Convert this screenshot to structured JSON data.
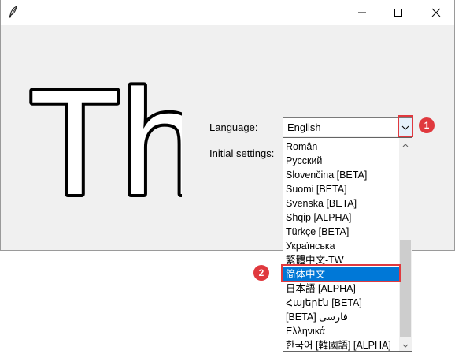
{
  "window": {
    "app_icon": "feather-icon",
    "controls": {
      "minimize": "minimize-icon",
      "maximize": "maximize-icon",
      "close": "close-icon"
    }
  },
  "logo": {
    "text": "Th"
  },
  "form": {
    "language_label": "Language:",
    "initial_settings_label": "Initial settings:",
    "language_value": "English"
  },
  "dropdown": {
    "items": [
      "Român",
      "Русский",
      "Slovenčina [BETA]",
      "Suomi [BETA]",
      "Svenska [BETA]",
      "Shqip [ALPHA]",
      "Türkçe [BETA]",
      "Українська",
      "繁體中文-TW",
      "简体中文",
      "日本語 [ALPHA]",
      "Հայերէն [BETA]",
      "[BETA] فارسی",
      "Ελληνικά",
      "한국어 [韓國語] [ALPHA]"
    ],
    "selected_index": 9
  },
  "annotations": {
    "badge_1": "1",
    "badge_2": "2",
    "color": "#e0393e"
  },
  "colors": {
    "selection": "#0078d7",
    "window_bg": "#f0f0f0"
  }
}
